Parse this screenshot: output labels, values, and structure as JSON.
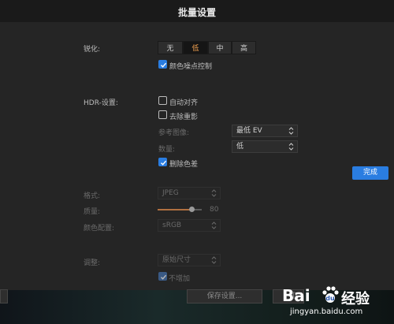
{
  "dialog": {
    "title": "批量设置"
  },
  "sharpen": {
    "label": "锐化:",
    "options": [
      "无",
      "低",
      "中",
      "高"
    ],
    "selected": "低"
  },
  "color_noise": {
    "label": "颜色噪点控制",
    "checked": true
  },
  "hdr": {
    "label": "HDR-设置:",
    "auto_align": {
      "label": "自动对齐",
      "checked": false
    },
    "remove_ghost": {
      "label": "去除重影",
      "checked": false
    },
    "reference": {
      "label": "参考图像:",
      "value": "最低 EV"
    },
    "amount": {
      "label": "数量:",
      "value": "低"
    },
    "remove_chroma": {
      "label": "删除色差",
      "checked": true
    }
  },
  "done_button": "完成",
  "export": {
    "format": {
      "label": "格式:",
      "value": "JPEG"
    },
    "quality": {
      "label": "质量:",
      "value": "80",
      "level": 0.8
    },
    "color_profile": {
      "label": "颜色配置:",
      "value": "sRGB"
    },
    "resize": {
      "label": "调整:",
      "value": "原始尺寸"
    },
    "no_enlarge": {
      "label": "不增加",
      "checked": true
    }
  },
  "footer": {
    "save_settings": "保存设置...",
    "other_button": "取"
  },
  "watermark": {
    "brand": "Bai",
    "brand2": "经验",
    "url": "jingyan.baidu.com"
  }
}
